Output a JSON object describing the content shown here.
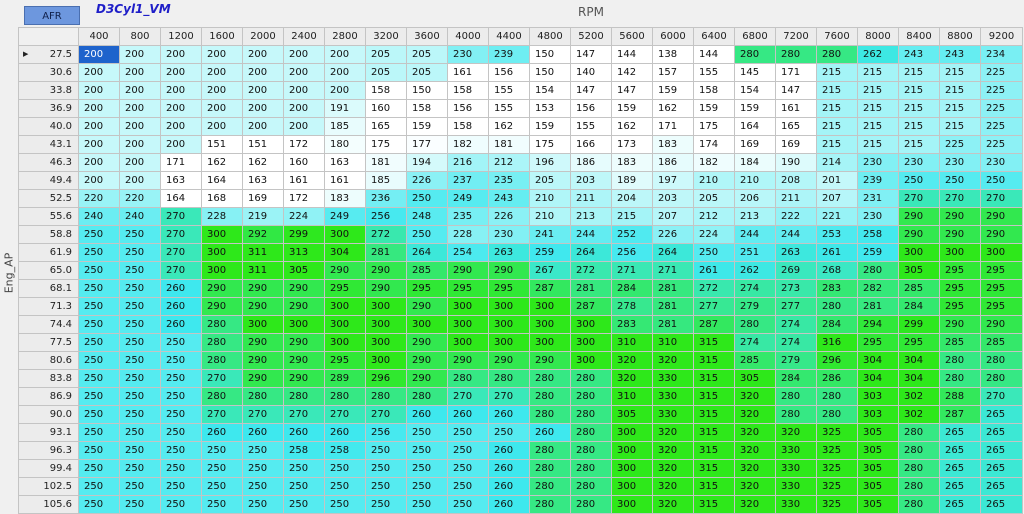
{
  "header": {
    "afr_button": "AFR",
    "map_name": "D3Cyl1_VM",
    "x_axis_title": "RPM",
    "y_axis_title": "Eng_AP"
  },
  "table": {
    "x_values": [
      "400",
      "800",
      "1200",
      "1600",
      "2000",
      "2400",
      "2800",
      "3200",
      "3600",
      "4000",
      "4400",
      "4800",
      "5200",
      "5600",
      "6000",
      "6400",
      "6800",
      "7200",
      "7600",
      "8000",
      "8400",
      "8800",
      "9200"
    ],
    "y_values": [
      "27.5",
      "30.6",
      "33.8",
      "36.9",
      "40.0",
      "43.1",
      "46.3",
      "49.4",
      "52.5",
      "55.6",
      "58.8",
      "61.9",
      "65.0",
      "68.1",
      "71.3",
      "74.4",
      "77.5",
      "80.6",
      "83.8",
      "86.9",
      "90.0",
      "93.1",
      "96.3",
      "99.4",
      "102.5",
      "105.6"
    ],
    "selected_row": 0,
    "selected_col": 0,
    "rows": [
      [
        200,
        200,
        200,
        200,
        200,
        200,
        200,
        205,
        205,
        230,
        239,
        150,
        147,
        144,
        138,
        144,
        280,
        280,
        280,
        262,
        243,
        243,
        234
      ],
      [
        200,
        200,
        200,
        200,
        200,
        200,
        200,
        205,
        205,
        161,
        156,
        150,
        140,
        142,
        157,
        155,
        145,
        171,
        215,
        215,
        215,
        215,
        225
      ],
      [
        200,
        200,
        200,
        200,
        200,
        200,
        200,
        158,
        150,
        158,
        155,
        154,
        147,
        147,
        159,
        158,
        154,
        147,
        215,
        215,
        215,
        215,
        225
      ],
      [
        200,
        200,
        200,
        200,
        200,
        200,
        191,
        160,
        158,
        156,
        155,
        153,
        156,
        159,
        162,
        159,
        159,
        161,
        215,
        215,
        215,
        215,
        225
      ],
      [
        200,
        200,
        200,
        200,
        200,
        200,
        185,
        165,
        159,
        158,
        162,
        159,
        155,
        162,
        171,
        175,
        164,
        165,
        215,
        215,
        215,
        215,
        225
      ],
      [
        200,
        200,
        200,
        151,
        151,
        172,
        180,
        175,
        177,
        182,
        181,
        175,
        166,
        173,
        183,
        174,
        169,
        169,
        215,
        215,
        215,
        225,
        225
      ],
      [
        200,
        200,
        171,
        162,
        162,
        160,
        163,
        181,
        194,
        216,
        212,
        196,
        186,
        183,
        186,
        182,
        184,
        190,
        214,
        230,
        230,
        230,
        230
      ],
      [
        200,
        200,
        163,
        164,
        163,
        161,
        161,
        185,
        226,
        237,
        235,
        205,
        203,
        189,
        197,
        210,
        210,
        208,
        201,
        239,
        250,
        250,
        250
      ],
      [
        220,
        220,
        164,
        168,
        169,
        172,
        183,
        236,
        250,
        249,
        243,
        210,
        211,
        204,
        203,
        205,
        206,
        211,
        207,
        231,
        270,
        270,
        270
      ],
      [
        240,
        240,
        270,
        228,
        219,
        224,
        249,
        256,
        248,
        235,
        226,
        210,
        213,
        215,
        207,
        212,
        213,
        222,
        221,
        230,
        290,
        290,
        290
      ],
      [
        250,
        250,
        270,
        300,
        292,
        299,
        300,
        272,
        250,
        228,
        230,
        241,
        244,
        252,
        226,
        224,
        244,
        244,
        253,
        258,
        290,
        290,
        290
      ],
      [
        250,
        250,
        270,
        300,
        311,
        313,
        304,
        281,
        264,
        254,
        263,
        259,
        264,
        256,
        264,
        250,
        251,
        263,
        261,
        259,
        300,
        300,
        300
      ],
      [
        250,
        250,
        270,
        300,
        311,
        305,
        290,
        290,
        285,
        290,
        290,
        267,
        272,
        271,
        271,
        261,
        262,
        269,
        268,
        280,
        305,
        295,
        295
      ],
      [
        250,
        250,
        260,
        290,
        290,
        290,
        295,
        290,
        295,
        295,
        295,
        287,
        281,
        284,
        281,
        272,
        274,
        273,
        283,
        282,
        285,
        295,
        295
      ],
      [
        250,
        250,
        260,
        290,
        290,
        290,
        300,
        300,
        290,
        300,
        300,
        300,
        287,
        278,
        281,
        277,
        279,
        277,
        280,
        281,
        284,
        295,
        295
      ],
      [
        250,
        250,
        260,
        280,
        300,
        300,
        300,
        300,
        300,
        300,
        300,
        300,
        300,
        283,
        281,
        287,
        280,
        274,
        284,
        294,
        299,
        290,
        290
      ],
      [
        250,
        250,
        250,
        280,
        290,
        290,
        300,
        300,
        290,
        300,
        300,
        300,
        300,
        310,
        310,
        315,
        274,
        274,
        316,
        295,
        295,
        285,
        285
      ],
      [
        250,
        250,
        250,
        280,
        290,
        290,
        295,
        300,
        290,
        290,
        290,
        290,
        300,
        320,
        320,
        315,
        285,
        279,
        296,
        304,
        304,
        280,
        280
      ],
      [
        250,
        250,
        250,
        270,
        290,
        290,
        289,
        296,
        290,
        280,
        280,
        280,
        280,
        320,
        330,
        315,
        305,
        284,
        286,
        304,
        304,
        280,
        280
      ],
      [
        250,
        250,
        250,
        280,
        280,
        280,
        280,
        280,
        280,
        270,
        270,
        280,
        280,
        310,
        330,
        315,
        320,
        280,
        280,
        303,
        302,
        288,
        270
      ],
      [
        250,
        250,
        250,
        270,
        270,
        270,
        270,
        270,
        260,
        260,
        260,
        280,
        280,
        305,
        330,
        315,
        320,
        280,
        280,
        303,
        302,
        287,
        265
      ],
      [
        250,
        250,
        250,
        260,
        260,
        260,
        260,
        256,
        250,
        250,
        250,
        260,
        280,
        300,
        320,
        315,
        320,
        320,
        325,
        305,
        280,
        265,
        265
      ],
      [
        250,
        250,
        250,
        250,
        250,
        258,
        258,
        250,
        250,
        250,
        260,
        280,
        280,
        300,
        320,
        315,
        320,
        330,
        325,
        305,
        280,
        265,
        265
      ],
      [
        250,
        250,
        250,
        250,
        250,
        250,
        250,
        250,
        250,
        250,
        260,
        280,
        280,
        300,
        320,
        315,
        320,
        330,
        325,
        305,
        280,
        265,
        265
      ],
      [
        250,
        250,
        250,
        250,
        250,
        250,
        250,
        250,
        250,
        250,
        260,
        280,
        280,
        300,
        320,
        315,
        320,
        330,
        325,
        305,
        280,
        265,
        265
      ],
      [
        250,
        250,
        250,
        250,
        250,
        250,
        250,
        250,
        250,
        250,
        260,
        280,
        280,
        300,
        320,
        315,
        320,
        330,
        325,
        305,
        280,
        265,
        265
      ]
    ]
  },
  "colors": {
    "low": "#ffffff",
    "mid": "#3ee8ee",
    "high": "#2ee81a",
    "selected": "#1e63cc"
  }
}
